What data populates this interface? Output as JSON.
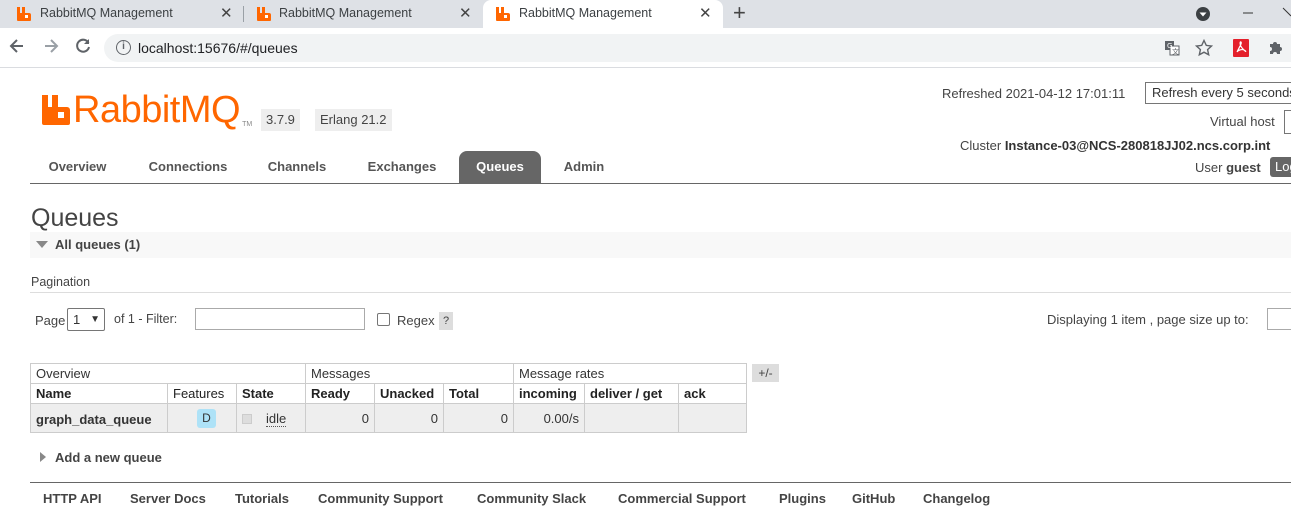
{
  "browser": {
    "tabs": [
      {
        "title": "RabbitMQ Management",
        "active": false
      },
      {
        "title": "RabbitMQ Management",
        "active": false
      },
      {
        "title": "RabbitMQ Management",
        "active": true
      }
    ],
    "new_tab": "+",
    "address": "localhost:15676/#/queues",
    "icons": [
      "back-arrow-icon",
      "forward-arrow-icon",
      "reload-icon",
      "site-info-icon",
      "translate-icon",
      "bookmark-star-icon",
      "pdf-extension-icon",
      "extensions-puzzle-icon",
      "profile-dropdown-icon",
      "minimize-icon",
      "close-window-icon"
    ]
  },
  "header": {
    "logo_text": "RabbitMQ",
    "logo_tm": "TM",
    "version": "3.7.9",
    "erlang": "Erlang 21.2",
    "refreshed": "Refreshed 2021-04-12 17:01:11",
    "refresh_option": "Refresh every 5 seconds",
    "virtual_host_label": "Virtual host",
    "cluster_label": "Cluster",
    "cluster_name": "Instance-03@NCS-280818JJ02.ncs.corp.int",
    "user_label": "User",
    "user_name": "guest",
    "logout": "Log out"
  },
  "menu": [
    {
      "label": "Overview",
      "selected": false
    },
    {
      "label": "Connections",
      "selected": false
    },
    {
      "label": "Channels",
      "selected": false
    },
    {
      "label": "Exchanges",
      "selected": false
    },
    {
      "label": "Queues",
      "selected": true
    },
    {
      "label": "Admin",
      "selected": false
    }
  ],
  "page": {
    "title": "Queues",
    "section": "All queues (1)",
    "pagination_label": "Pagination",
    "page_label": "Page",
    "page_value": "1",
    "of_label": "of 1  - Filter:",
    "filter_value": "",
    "regex_label": "Regex",
    "regex_help": "?",
    "displaying": "Displaying 1 item , page size up to:",
    "page_size_value": ""
  },
  "table": {
    "groups": [
      "Overview",
      "Messages",
      "Message rates"
    ],
    "columns": [
      "Name",
      "Features",
      "State",
      "Ready",
      "Unacked",
      "Total",
      "incoming",
      "deliver / get",
      "ack"
    ],
    "plus_minus": "+/-",
    "rows": [
      {
        "name": "graph_data_queue",
        "feature": "D",
        "state": "idle",
        "ready": "0",
        "unacked": "0",
        "total": "0",
        "incoming": "0.00/s",
        "deliver_get": "",
        "ack": ""
      }
    ]
  },
  "add_queue": "Add a new queue",
  "footer": [
    "HTTP API",
    "Server Docs",
    "Tutorials",
    "Community Support",
    "Community Slack",
    "Commercial Support",
    "Plugins",
    "GitHub",
    "Changelog"
  ],
  "colors": {
    "brand": "#ff6600",
    "menu_selected": "#666666",
    "feature_badge": "#aee2f7"
  }
}
